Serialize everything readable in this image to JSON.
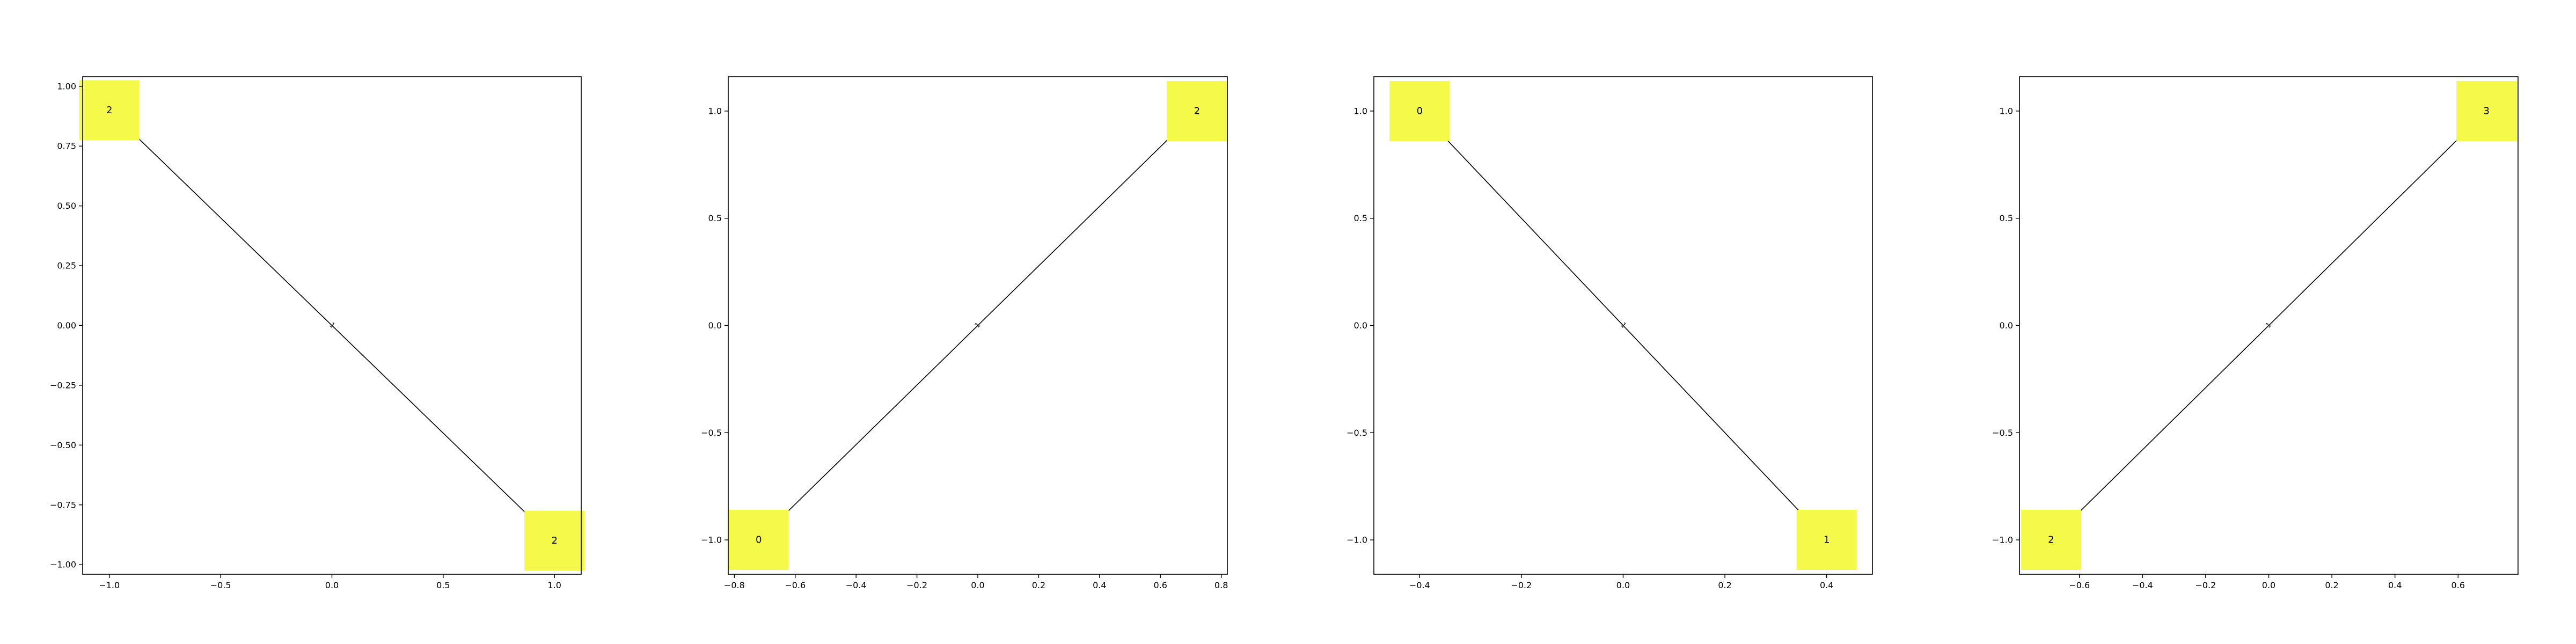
{
  "figure": {
    "background": "#ffffff"
  },
  "style": {
    "node_color": "#f4f94a",
    "edge_color": "#000000",
    "axis_color": "#000000",
    "text_color": "#000000"
  },
  "chart_data": [
    {
      "type": "network",
      "xlim": [
        -1.12,
        1.12
      ],
      "ylim": [
        -1.04,
        1.04
      ],
      "xticks": [
        -1.0,
        -0.5,
        0.0,
        0.5,
        1.0
      ],
      "xtick_labels": [
        "−1.0",
        "−0.5",
        "0.0",
        "0.5",
        "1.0"
      ],
      "yticks": [
        -1.0,
        -0.75,
        -0.5,
        -0.25,
        0.0,
        0.25,
        0.5,
        0.75,
        1.0
      ],
      "ytick_labels": [
        "−1.00",
        "−0.75",
        "−0.50",
        "−0.25",
        "0.00",
        "0.25",
        "0.50",
        "0.75",
        "1.00"
      ],
      "nodes": [
        {
          "label": "2",
          "x": -1.0,
          "y": 0.9
        },
        {
          "label": "2",
          "x": 1.0,
          "y": -0.9
        }
      ],
      "edges": [
        {
          "from": 0,
          "to": 1,
          "label": "1"
        }
      ]
    },
    {
      "type": "network",
      "xlim": [
        -0.82,
        0.82
      ],
      "ylim": [
        -1.16,
        1.16
      ],
      "xticks": [
        -0.8,
        -0.6,
        -0.4,
        -0.2,
        0.0,
        0.2,
        0.4,
        0.6,
        0.8
      ],
      "xtick_labels": [
        "−0.8",
        "−0.6",
        "−0.4",
        "−0.2",
        "0.0",
        "0.2",
        "0.4",
        "0.6",
        "0.8"
      ],
      "yticks": [
        -1.0,
        -0.5,
        0.0,
        0.5,
        1.0
      ],
      "ytick_labels": [
        "−1.0",
        "−0.5",
        "0.0",
        "0.5",
        "1.0"
      ],
      "nodes": [
        {
          "label": "0",
          "x": -0.72,
          "y": -1.0
        },
        {
          "label": "2",
          "x": 0.72,
          "y": 1.0
        }
      ],
      "edges": [
        {
          "from": 0,
          "to": 1,
          "label": "1"
        }
      ]
    },
    {
      "type": "network",
      "xlim": [
        -0.49,
        0.49
      ],
      "ylim": [
        -1.16,
        1.16
      ],
      "xticks": [
        -0.4,
        -0.2,
        0.0,
        0.2,
        0.4
      ],
      "xtick_labels": [
        "−0.4",
        "−0.2",
        "0.0",
        "0.2",
        "0.4"
      ],
      "yticks": [
        -1.0,
        -0.5,
        0.0,
        0.5,
        1.0
      ],
      "ytick_labels": [
        "−1.0",
        "−0.5",
        "0.0",
        "0.5",
        "1.0"
      ],
      "nodes": [
        {
          "label": "0",
          "x": -0.4,
          "y": 1.0
        },
        {
          "label": "1",
          "x": 0.4,
          "y": -1.0
        }
      ],
      "edges": [
        {
          "from": 0,
          "to": 1,
          "label": "1"
        }
      ]
    },
    {
      "type": "network",
      "xlim": [
        -0.79,
        0.79
      ],
      "ylim": [
        -1.16,
        1.16
      ],
      "xticks": [
        -0.6,
        -0.4,
        -0.2,
        0.0,
        0.2,
        0.4,
        0.6
      ],
      "xtick_labels": [
        "−0.6",
        "−0.4",
        "−0.2",
        "0.0",
        "0.2",
        "0.4",
        "0.6"
      ],
      "yticks": [
        -1.0,
        -0.5,
        0.0,
        0.5,
        1.0
      ],
      "ytick_labels": [
        "−1.0",
        "−0.5",
        "0.0",
        "0.5",
        "1.0"
      ],
      "nodes": [
        {
          "label": "2",
          "x": -0.69,
          "y": -1.0
        },
        {
          "label": "3",
          "x": 0.69,
          "y": 1.0
        }
      ],
      "edges": [
        {
          "from": 0,
          "to": 1,
          "label": "1"
        }
      ]
    }
  ]
}
